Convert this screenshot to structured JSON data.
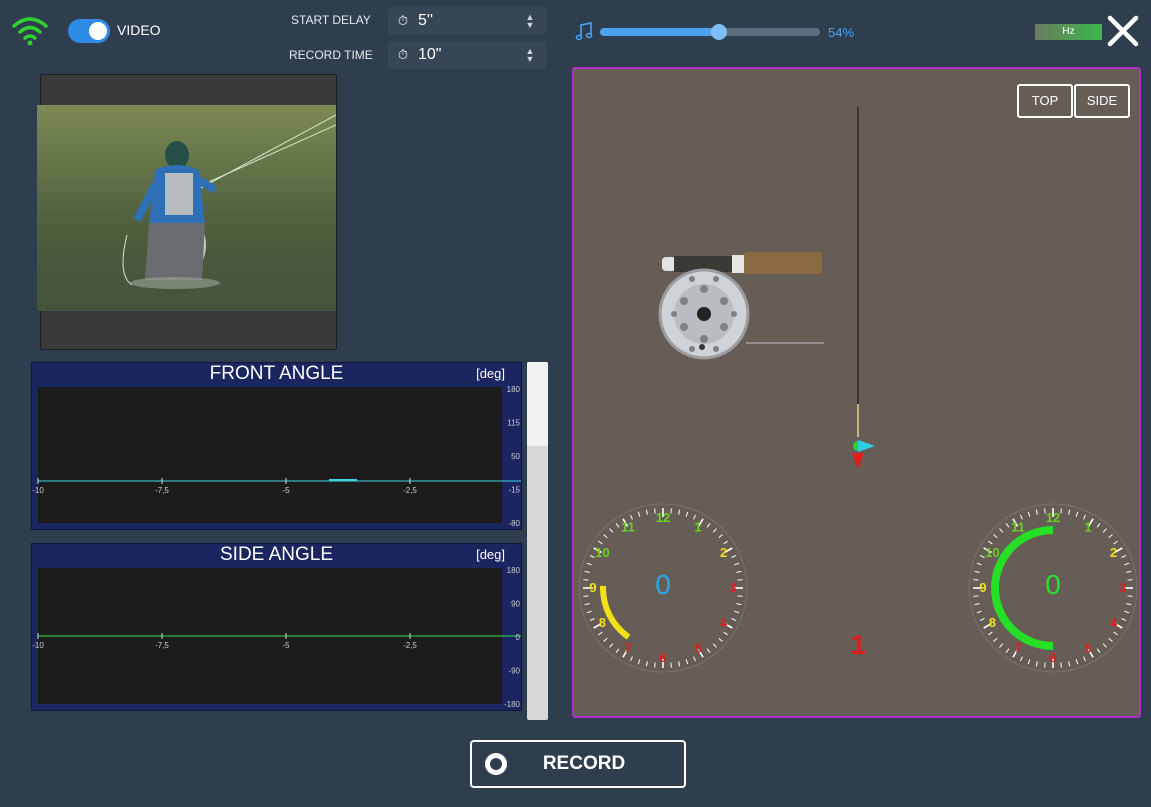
{
  "header": {
    "video_toggle": {
      "label": "VIDEO",
      "on": true
    },
    "start_delay": {
      "label": "START DELAY",
      "value": "5''"
    },
    "record_time": {
      "label": "RECORD TIME",
      "value": "10\""
    },
    "volume": {
      "value_text": "54%",
      "fraction": 0.54
    },
    "hz_label": "Hz"
  },
  "charts": [
    {
      "title": "FRONT ANGLE",
      "unit": "[deg]",
      "x_ticks": [
        "-10",
        "-7,5",
        "-5",
        "-2,5"
      ],
      "y_ticks": [
        "180",
        "115",
        "50",
        "-15",
        "-80"
      ],
      "line_color": "#3fd6e0"
    },
    {
      "title": "SIDE ANGLE",
      "unit": "[deg]",
      "x_ticks": [
        "-10",
        "-7,5",
        "-5",
        "-2,5"
      ],
      "y_ticks": [
        "180",
        "90",
        "0",
        "-90",
        "-180"
      ],
      "line_color": "#33e04a"
    }
  ],
  "viewport": {
    "top_button": "TOP",
    "side_button": "SIDE",
    "left_gauge_value": "0",
    "right_gauge_value": "0",
    "center_count": "1"
  },
  "clock_numbers": [
    "12",
    "1",
    "2",
    "3",
    "4",
    "5",
    "6",
    "7",
    "8",
    "9",
    "10",
    "11"
  ],
  "record_button": "RECORD",
  "colors": {
    "accent": "#4aa3f0",
    "viewport_border": "#b02fc6",
    "wifi": "#2fd12f",
    "left_gauge_value": "#2aa7e8",
    "right_gauge_value": "#2be02b",
    "center_count": "#e01e1e"
  }
}
